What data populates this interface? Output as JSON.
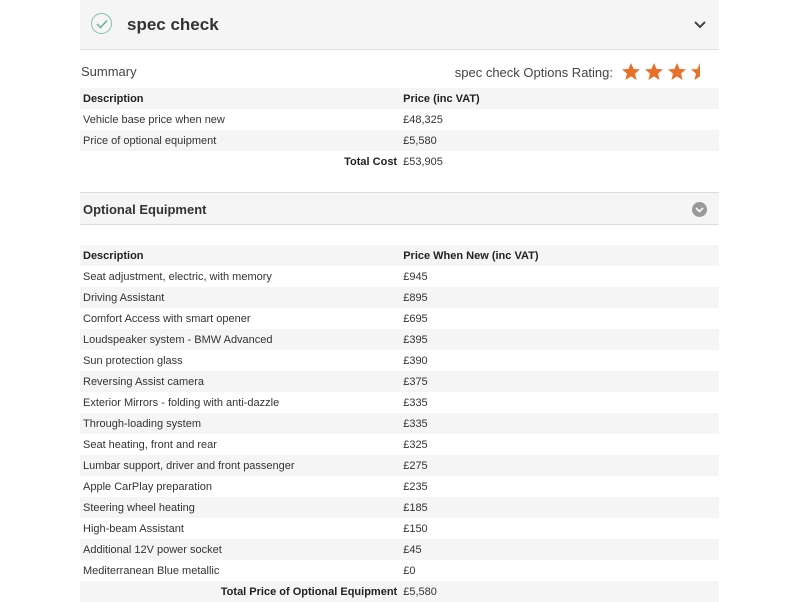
{
  "header": {
    "title": "spec check"
  },
  "summary": {
    "label": "Summary",
    "rating_label": "spec check Options Rating:",
    "rating_stars": 3.5,
    "rating_max": 4,
    "star_color": "#e8702a",
    "columns": [
      "Description",
      "Price (inc VAT)"
    ],
    "rows": [
      {
        "description": "Vehicle base price when new",
        "price": "£48,325"
      },
      {
        "description": "Price of optional equipment",
        "price": "£5,580"
      }
    ],
    "total_label": "Total Cost",
    "total_value": "£53,905"
  },
  "optional": {
    "title": "Optional Equipment",
    "columns": [
      "Description",
      "Price When New (inc VAT)"
    ],
    "rows": [
      {
        "description": "Seat adjustment, electric, with memory",
        "price": "£945"
      },
      {
        "description": "Driving Assistant",
        "price": "£895"
      },
      {
        "description": "Comfort Access with smart opener",
        "price": "£695"
      },
      {
        "description": "Loudspeaker system - BMW Advanced",
        "price": "£395"
      },
      {
        "description": "Sun protection glass",
        "price": "£390"
      },
      {
        "description": "Reversing Assist camera",
        "price": "£375"
      },
      {
        "description": "Exterior Mirrors - folding with anti-dazzle",
        "price": "£335"
      },
      {
        "description": "Through-loading system",
        "price": "£335"
      },
      {
        "description": "Seat heating, front and rear",
        "price": "£325"
      },
      {
        "description": "Lumbar support, driver and front passenger",
        "price": "£275"
      },
      {
        "description": "Apple CarPlay preparation",
        "price": "£235"
      },
      {
        "description": "Steering wheel heating",
        "price": "£185"
      },
      {
        "description": "High-beam Assistant",
        "price": "£150"
      },
      {
        "description": "Additional 12V power socket",
        "price": "£45"
      },
      {
        "description": "Mediterranean Blue metallic",
        "price": "£0"
      }
    ],
    "total_label": "Total Price of Optional Equipment",
    "total_value": "£5,580"
  }
}
